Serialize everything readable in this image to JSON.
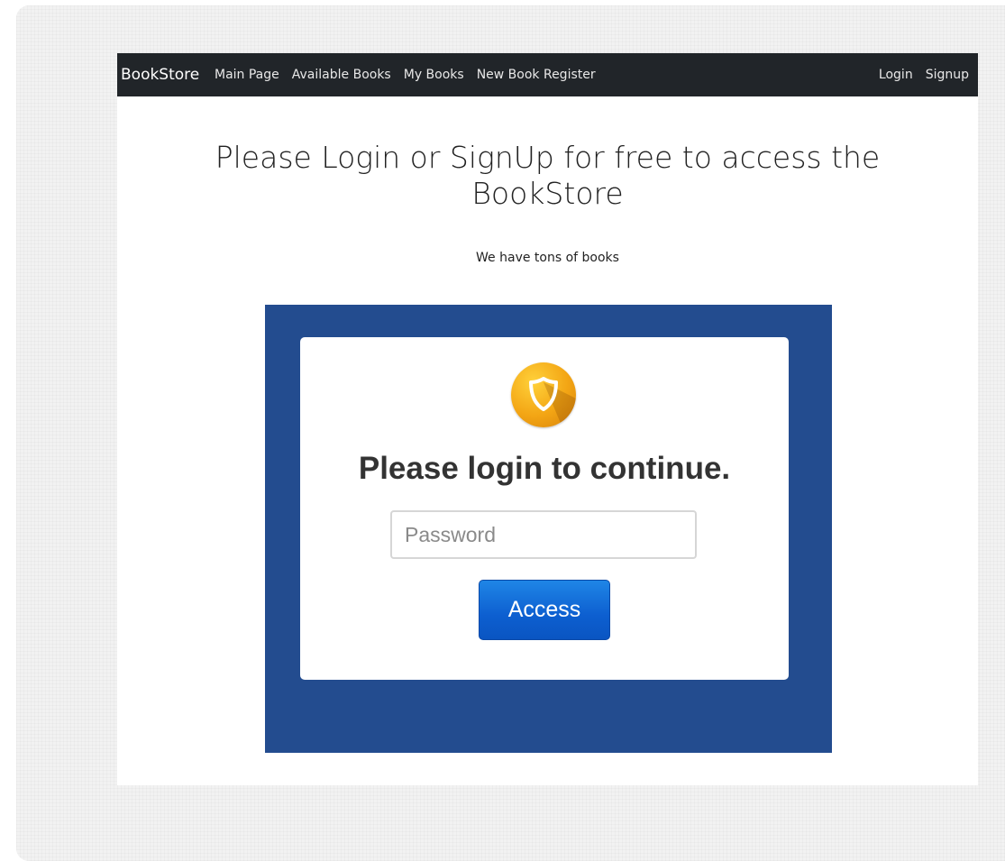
{
  "navbar": {
    "brand": "BookStore",
    "links": [
      "Main Page",
      "Available Books",
      "My Books",
      "New Book Register"
    ],
    "right_links": [
      "Login",
      "Signup"
    ],
    "background_color": "#212529"
  },
  "hero": {
    "title": "Please Login or SignUp for free to access the BookStore",
    "subtitle": "We have tons of books"
  },
  "login_card": {
    "icon": "shield-icon",
    "heading": "Please login to continue.",
    "password_placeholder": "Password",
    "password_value": "",
    "access_button_label": "Access",
    "panel_color": "#234c8f",
    "badge_color": "#f3a514",
    "button_color": "#0d5fd0"
  }
}
